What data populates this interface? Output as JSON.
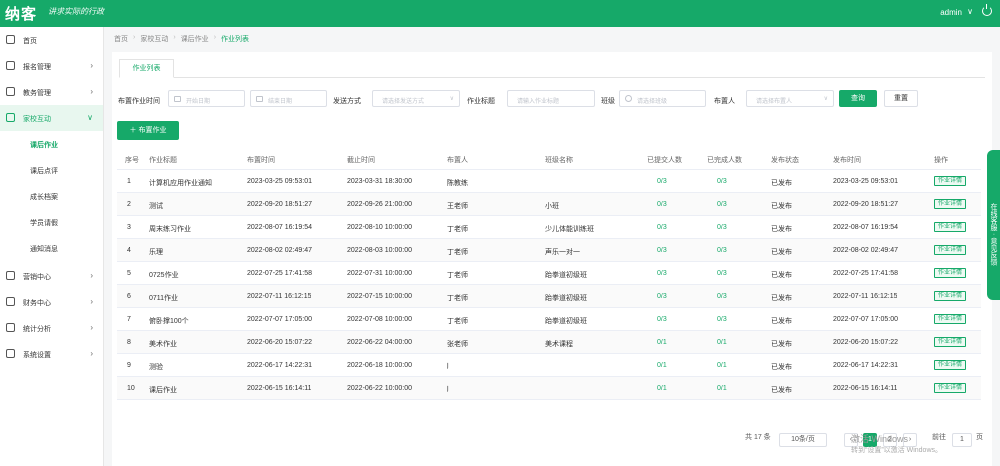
{
  "header": {
    "logo": "纳客",
    "slogan": "讲求实际的行政",
    "user": "admin",
    "caret": "∨"
  },
  "sidebar": {
    "items": [
      {
        "label": "首页",
        "icon": "home-icon",
        "chevron": ""
      },
      {
        "label": "报名管理",
        "icon": "signup-icon",
        "chevron": "›"
      },
      {
        "label": "教务管理",
        "icon": "academic-icon",
        "chevron": "›"
      },
      {
        "label": "家校互动",
        "icon": "home-school-icon",
        "chevron": "∨"
      },
      {
        "label": "营销中心",
        "icon": "marketing-icon",
        "chevron": "›"
      },
      {
        "label": "财务中心",
        "icon": "finance-icon",
        "chevron": "›"
      },
      {
        "label": "统计分析",
        "icon": "stats-icon",
        "chevron": "›"
      },
      {
        "label": "系统设置",
        "icon": "settings-icon",
        "chevron": "›"
      }
    ],
    "sub_items": [
      "课后作业",
      "课后点评",
      "成长档案",
      "学员请假",
      "通知消息"
    ],
    "active_sub": "课后作业"
  },
  "breadcrumb": [
    "首页",
    "家校互动",
    "课后作业",
    "作业列表"
  ],
  "tab": "作业列表",
  "filters": {
    "date_label": "布置作业时间",
    "start_placeholder": "开始日期",
    "end_placeholder": "结束日期",
    "send_label": "发送方式",
    "send_placeholder": "请选择发送方式",
    "name_label": "作业标题",
    "name_placeholder": "请输入作业标题",
    "class_label": "班级",
    "class_placeholder": "请选择班级",
    "teacher_label": "布置人",
    "teacher_placeholder": "请选择布置人",
    "search_button": "查询",
    "reset_button": "重置",
    "add_button": "＋ 布置作业"
  },
  "table": {
    "columns": [
      "序号",
      "作业标题",
      "布置时间",
      "截止时间",
      "布置人",
      "班级名称",
      "已提交人数",
      "已完成人数",
      "发布状态",
      "发布时间",
      "操作"
    ],
    "rows": [
      {
        "no": "1",
        "title": "计算机应用作业通知",
        "assign": "2023-03-25 09:53:01",
        "due": "2023-03-31 18:30:00",
        "teacher": "陈教练",
        "class": "",
        "submitted": "0/3",
        "completed": "0/3",
        "status": "已发布",
        "publish": "2023-03-25 09:53:01",
        "op": "作业详情"
      },
      {
        "no": "2",
        "title": "测试",
        "assign": "2022-09-20 18:51:27",
        "due": "2022-09-26 21:00:00",
        "teacher": "王老师",
        "class": "小班",
        "submitted": "0/3",
        "completed": "0/3",
        "status": "已发布",
        "publish": "2022-09-20 18:51:27",
        "op": "作业详情"
      },
      {
        "no": "3",
        "title": "周末练习作业",
        "assign": "2022-08-07 16:19:54",
        "due": "2022-08-10 10:00:00",
        "teacher": "丁老师",
        "class": "少儿体能训练班",
        "submitted": "0/3",
        "completed": "0/3",
        "status": "已发布",
        "publish": "2022-08-07 16:19:54",
        "op": "作业详情"
      },
      {
        "no": "4",
        "title": "乐理",
        "assign": "2022-08-02 02:49:47",
        "due": "2022-08-03 10:00:00",
        "teacher": "丁老师",
        "class": "声乐一对一",
        "submitted": "0/3",
        "completed": "0/3",
        "status": "已发布",
        "publish": "2022-08-02 02:49:47",
        "op": "作业详情"
      },
      {
        "no": "5",
        "title": "0725作业",
        "assign": "2022-07-25 17:41:58",
        "due": "2022-07-31 10:00:00",
        "teacher": "丁老师",
        "class": "跆拳道初级班",
        "submitted": "0/3",
        "completed": "0/3",
        "status": "已发布",
        "publish": "2022-07-25 17:41:58",
        "op": "作业详情"
      },
      {
        "no": "6",
        "title": "0711作业",
        "assign": "2022-07-11 16:12:15",
        "due": "2022-07-15 10:00:00",
        "teacher": "丁老师",
        "class": "跆拳道初级班",
        "submitted": "0/3",
        "completed": "0/3",
        "status": "已发布",
        "publish": "2022-07-11 16:12:15",
        "op": "作业详情"
      },
      {
        "no": "7",
        "title": "俯卧撑100个",
        "assign": "2022-07-07 17:05:00",
        "due": "2022-07-08 10:00:00",
        "teacher": "丁老师",
        "class": "跆拳道初级班",
        "submitted": "0/3",
        "completed": "0/3",
        "status": "已发布",
        "publish": "2022-07-07 17:05:00",
        "op": "作业详情"
      },
      {
        "no": "8",
        "title": "美术作业",
        "assign": "2022-06-20 15:07:22",
        "due": "2022-06-22 04:00:00",
        "teacher": "张老师",
        "class": "美术课程",
        "submitted": "0/1",
        "completed": "0/1",
        "status": "已发布",
        "publish": "2022-06-20 15:07:22",
        "op": "作业详情"
      },
      {
        "no": "9",
        "title": "测验",
        "assign": "2022-06-17 14:22:31",
        "due": "2022-06-18 10:00:00",
        "teacher": "j",
        "class": "",
        "submitted": "0/1",
        "completed": "0/1",
        "status": "已发布",
        "publish": "2022-06-17 14:22:31",
        "op": "作业详情"
      },
      {
        "no": "10",
        "title": "课后作业",
        "assign": "2022-06-15 16:14:11",
        "due": "2022-06-22 10:00:00",
        "teacher": "j",
        "class": "",
        "submitted": "0/1",
        "completed": "0/1",
        "status": "已发布",
        "publish": "2022-06-15 16:14:11",
        "op": "作业详情"
      }
    ]
  },
  "pagination": {
    "total": "共 17 条",
    "page_size": "10条/页",
    "prev": "‹",
    "pages": [
      "1",
      "2"
    ],
    "current": "1",
    "next": "›",
    "goto_label": "前往",
    "goto_value": "1",
    "goto_suffix": "页"
  },
  "float_tab": "在线客服 · 意见反馈",
  "watermark": {
    "line1": "激活 Windows",
    "line2": "转到“设置”以激活 Windows。"
  }
}
